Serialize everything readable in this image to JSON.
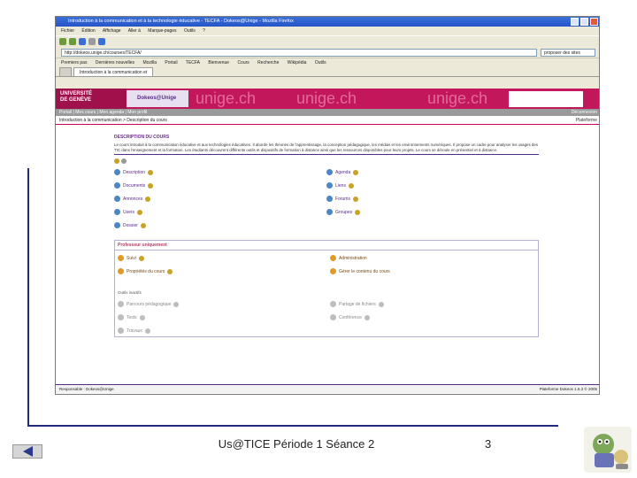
{
  "slide": {
    "caption": "Us@TICE Période 1 Séance 2",
    "page_number": "3"
  },
  "browser": {
    "title": "Introduction à la communication et à la technologie éducative - TECFA - Dokeos@Unige - Mozilla Firefox",
    "menu": [
      "Fichier",
      "Édition",
      "Affichage",
      "Aller à",
      "Marque-pages",
      "Outils",
      "?"
    ],
    "address": "http://dokeos.unige.ch/courses/TECFA/",
    "search_placeholder": "proposer des sites",
    "links": [
      "Premiers pas",
      "Dernières nouvelles",
      "Mozilla",
      "Portail",
      "TECFA",
      "Bienvenue",
      "Cours",
      "Recherche",
      "Wikipédia",
      "Outils"
    ],
    "tabs": [
      "",
      "Introduction à la communication et"
    ]
  },
  "page": {
    "logo_line1": "UNIVERSITÉ",
    "logo_line2": "DE GENÈVE",
    "site_name": "Dokeos@Unige",
    "watermark": "unige.ch",
    "subbar_left": "Portail | Mes cours | Mon agenda | Mon profil",
    "subbar_right": "Déconnexion",
    "breadcrumb": "Introduction à la communication > Description du cours",
    "breadcrumb_right": "Plateforme",
    "description_title": "DESCRIPTION DU COURS",
    "description_text": "Le cours introduit à la communication éducative et aux technologies éducatives. Il aborde les théories de l'apprentissage, la conception pédagogique, les médias et les environnements numériques. Il propose un cadre pour analyser les usages des TIC dans l'enseignement et la formation. Les étudiants découvrent différents outils et dispositifs de formation à distance ainsi que les ressources disponibles pour leurs projets. Le cours se déroule en présentiel et à distance.",
    "tools_left": [
      "Description",
      "Documents",
      "Annonces",
      "Users",
      "Dossier"
    ],
    "tools_right": [
      "Agenda",
      "Liens",
      "Forums",
      "Groupes"
    ],
    "admin_title": "Professeur uniquement",
    "admin_left": [
      "Suivi",
      "Propriétés du cours"
    ],
    "admin_right": [
      "Administration",
      "Gérer le contenu du cours"
    ],
    "inactive_label": "Outils inactifs",
    "inactive_left": [
      "Parcours pédagogique",
      "Tests",
      "Travaux"
    ],
    "inactive_right": [
      "Partage de fichiers",
      "Conférence"
    ],
    "footer_left": "Responsable : Dokeos@Unige",
    "footer_right": "Plateforme Dokeos 1.6.3 © 2005"
  },
  "colors": {
    "banner": "#c2185b",
    "slide_rule": "#1f2a7a",
    "admin_border": "#b3b3d6"
  },
  "icons": [
    "prev-slide-icon",
    "mascot-icon",
    "tool-icon",
    "visibility-eye-icon"
  ]
}
